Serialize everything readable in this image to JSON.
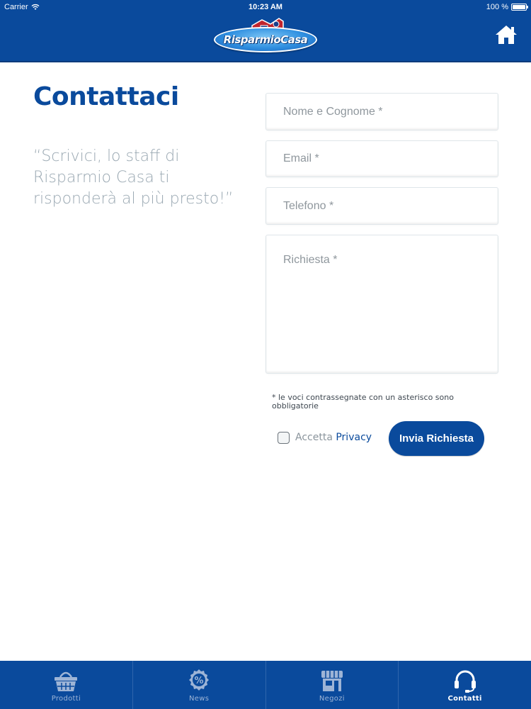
{
  "status_bar": {
    "carrier": "Carrier",
    "time": "10:23 AM",
    "battery": "100 %"
  },
  "header": {
    "logo_text": "RisparmioCasa"
  },
  "main": {
    "title": "Contattaci",
    "quote": "“Scrivici, lo staff di Risparmio Casa ti risponderà al più presto!”"
  },
  "form": {
    "name_placeholder": "Nome e Cognome *",
    "email_placeholder": "Email *",
    "phone_placeholder": "Telefono *",
    "message_placeholder": "Richiesta *",
    "required_note": "* le voci contrassegnate con un asterisco sono obbligatorie",
    "privacy_prefix": "Accetta",
    "privacy_link": "Privacy",
    "submit_label": "Invia Richiesta"
  },
  "tabbar": {
    "tabs": [
      {
        "label": "Prodotti",
        "icon": "basket-icon"
      },
      {
        "label": "News",
        "icon": "percent-badge-icon"
      },
      {
        "label": "Negozi",
        "icon": "store-icon"
      },
      {
        "label": "Contatti",
        "icon": "headset-icon",
        "active": true
      }
    ]
  },
  "colors": {
    "brand_blue": "#0a4a9c",
    "quote_gray": "#9aa8b2",
    "tab_inactive": "#9db4d6"
  }
}
